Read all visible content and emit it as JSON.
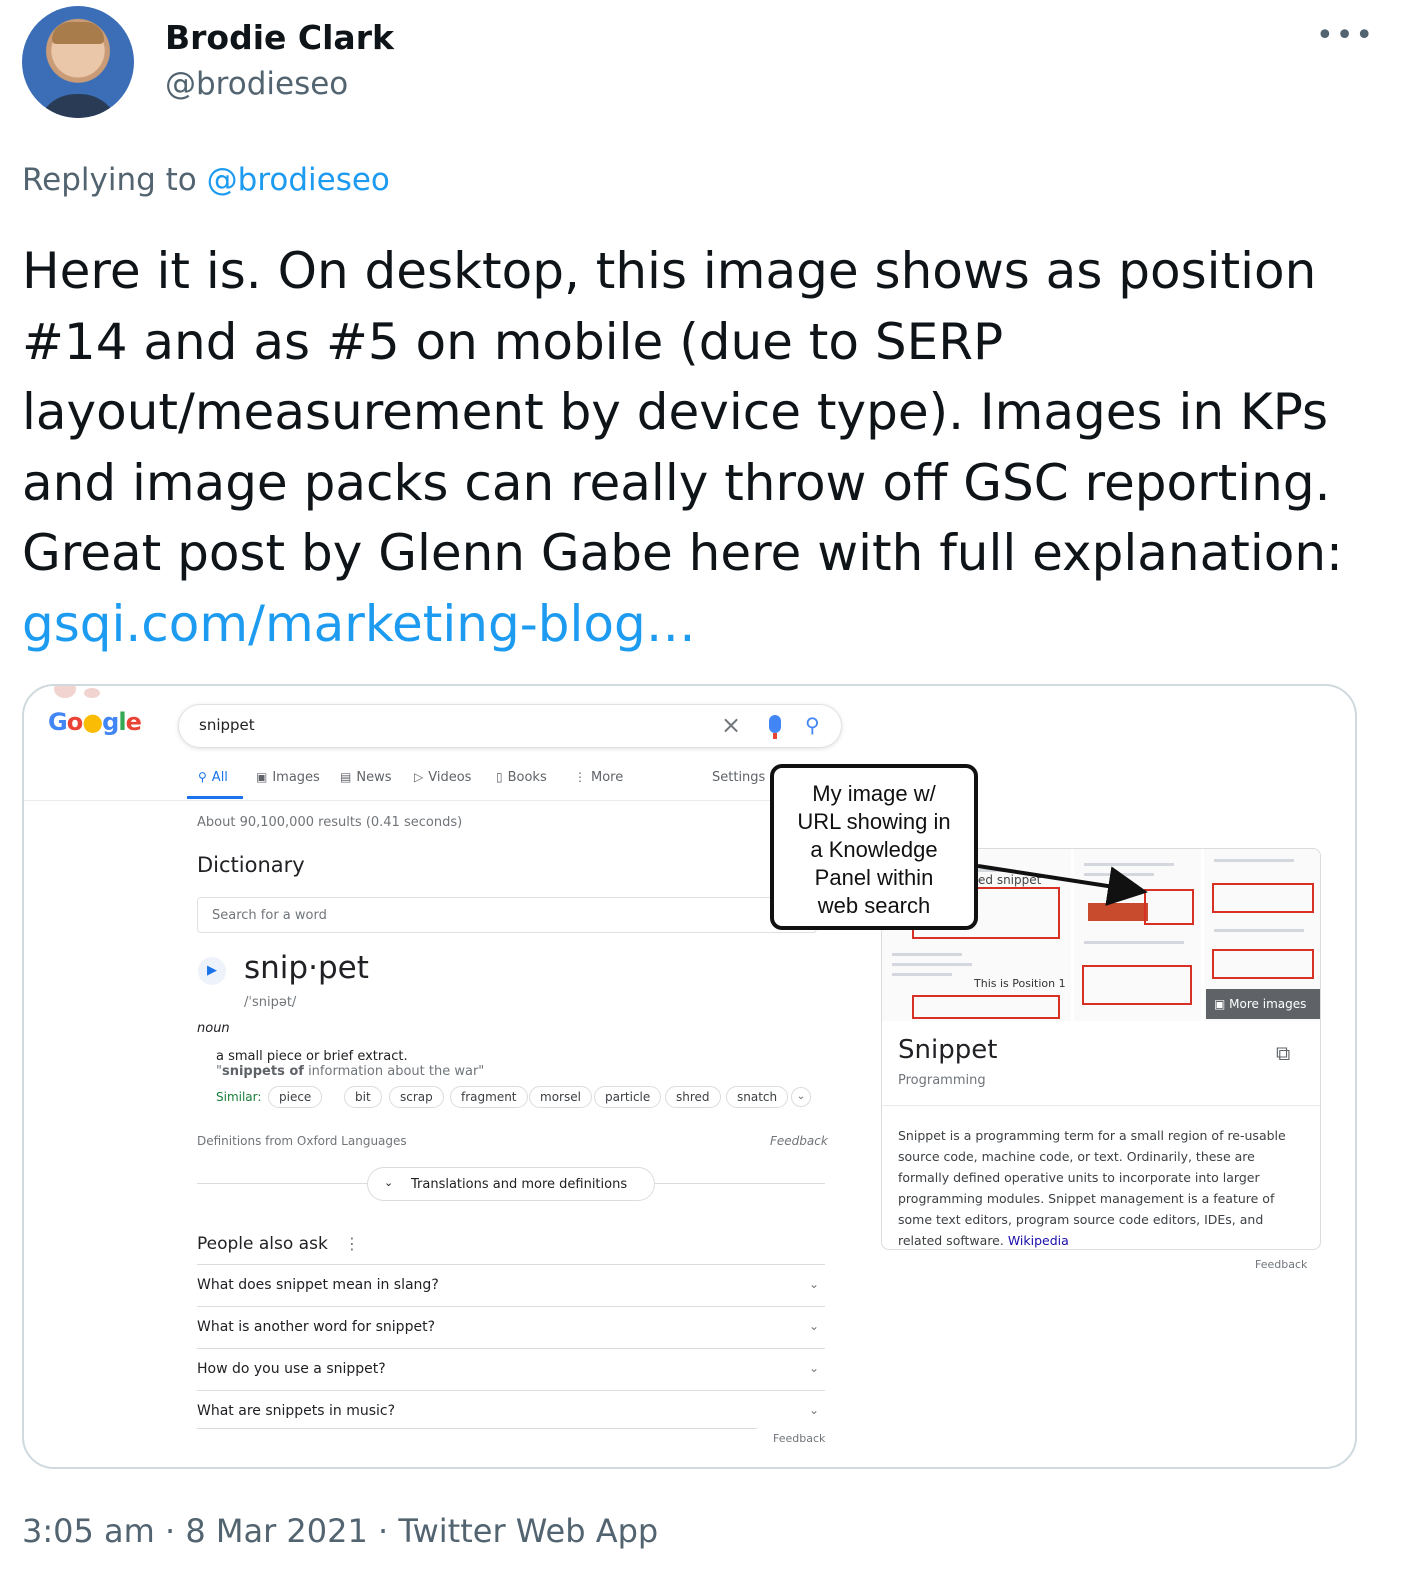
{
  "tweet": {
    "author_name": "Brodie Clark",
    "author_handle": "@brodieseo",
    "more_icon": "more-horizontal-icon",
    "replying_prefix": "Replying to",
    "replying_handle": "@brodieseo",
    "text": "Here it is. On desktop, this image shows as position #14 and as #5 on mobile (due to SERP layout/measurement by device type). Images in KPs and image packs can really throw off GSC reporting. Great post by Glenn Gabe here with full explanation: ",
    "link_text": "gsqi.com/marketing-blog…",
    "timestamp": "3:05 am · 8 Mar 2021 · Twitter Web App"
  },
  "screenshot": {
    "logo": "Google",
    "search_query": "snippet",
    "tabs": [
      {
        "label": "All",
        "icon": "search-icon"
      },
      {
        "label": "Images",
        "icon": "image-icon"
      },
      {
        "label": "News",
        "icon": "news-icon"
      },
      {
        "label": "Videos",
        "icon": "video-icon"
      },
      {
        "label": "Books",
        "icon": "book-icon"
      },
      {
        "label": "More",
        "icon": "more-vertical-icon"
      }
    ],
    "settings_label": "Settings",
    "results_count": "About 90,100,000 results (0.41 seconds)",
    "dictionary": {
      "title": "Dictionary",
      "search_placeholder": "Search for a word",
      "word": "snip·pet",
      "phonetic": "/ˈsnipət/",
      "part_of_speech": "noun",
      "definition": "a small piece or brief extract.",
      "example_bold": "snippets of",
      "example_rest": " information about the war\"",
      "similar_label": "Similar:",
      "similar": [
        "piece",
        "bit",
        "scrap",
        "fragment",
        "morsel",
        "particle",
        "shred",
        "snatch"
      ],
      "source": "Definitions from Oxford Languages",
      "feedback": "Feedback",
      "translations_button": "Translations and more definitions"
    },
    "people_also_ask": {
      "title": "People also ask",
      "questions": [
        "What does snippet mean in slang?",
        "What is another word for snippet?",
        "How do you use a snippet?",
        "What are snippets in music?"
      ],
      "feedback": "Feedback"
    },
    "knowledge_panel": {
      "title": "Snippet",
      "subtitle": "Programming",
      "more_images": "More images",
      "position_label": "This is Position 1",
      "snippet_fragment": "ed snippet",
      "description": "Snippet is a programming term for a small region of re-usable source code, machine code, or text. Ordinarily, these are formally defined operative units to incorporate into larger programming modules. Snippet management is a feature of some text editors, program source code editors, IDEs, and related software. ",
      "source_link": "Wikipedia",
      "feedback": "Feedback"
    },
    "callout": {
      "lines": [
        "My image w/",
        "URL showing in",
        "a Knowledge",
        "Panel within",
        "web search"
      ],
      "border_color": "#111111"
    }
  },
  "colors": {
    "link_blue": "#1d9bf0",
    "google_blue": "#1a73e8",
    "annotation_red": "#d93025"
  }
}
